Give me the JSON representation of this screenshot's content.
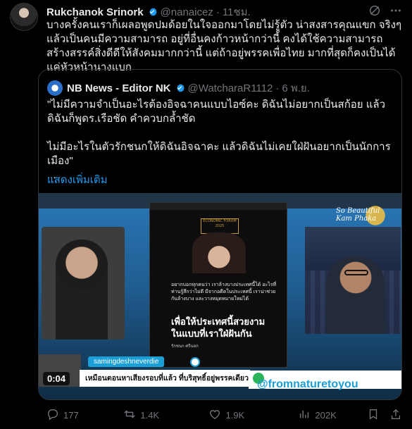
{
  "post": {
    "author_name": "Rukchanok Srinork",
    "author_handle": "@nanaicez",
    "separator": "·",
    "time": "11ชม.",
    "text": "บางครั้งคนเราก็เผลอพูดปมด้อยในใจออกมาโดยไม่รู้ตัว น่าสงสารคุณแขก จริงๆแล้วเป็นคนมีความสามารถ อยู่ที่อื่นคงก้าวหน้ากว่านี้ คงได้ใช้ความสามารถสร้างสรรค์สิ่งดีดีให้สังคมมากกว่านี้ แต่ถ้าอยู่พรรคเพื่อไทย มากที่สุดก็คงเป็นได้แค่หัวหน้านางแบก"
  },
  "quote": {
    "author_name": "NB News - Editor NK",
    "author_handle": "@WatcharaR1112",
    "separator": "·",
    "time": "6 พ.ย.",
    "text": "\"ไม่มีความจำเป็นอะไรต้องอิจฉาคนแบบไอซ์คะ ดิฉันไม่อยากเป็นสก้อย แล้วดิฉันก็พูดร.เรือชัด คำควบกล้ำชัด\n\nไม่มีอะไรในตัวรักชนกให้ดิฉันอิจฉาคะ แล้วดิฉันไม่เคยใฝ่ฝันอยากเป็นนักการเมือง\"\n...",
    "show_more": "แสดงเพิ่มเติม"
  },
  "media": {
    "duration": "0:04",
    "chat_user": "samingdeshneverdie",
    "ticker_text": "เหมือนตอนหาเสียงรอบที่แล้ว ที่บริสุทธิ์อยู่พรรคเดียว",
    "channel": "@fromnaturetoyou",
    "brand": "So Beautiful Kam Phaka",
    "slide_quote": "อยากบอกทุกคนว่า เราล้างบางประเทศนี้ได้ อะไรที่ท่านรู้สึกว่าไม่ดี มีจากอดีตในประเทศนี้ เราน่าช่วยกันล้างบาง และวางหมุดหมายใหม่ได้",
    "slide_headline": "เพื่อให้ประเทศนี้สวยงาม ในแบบที่เราใฝ่ฝันกัน",
    "slide_sign": "รักชนก ศรีนอก",
    "slide_logo": "ECONOMIC FORUM 2025"
  },
  "actions": {
    "replies": "177",
    "reposts": "1.4K",
    "likes": "1.9K",
    "views": "202K"
  },
  "colors": {
    "background": "#000000",
    "text": "#e7e9ea",
    "muted": "#71767b",
    "link": "#1d9bf0",
    "border": "#2f3336"
  }
}
